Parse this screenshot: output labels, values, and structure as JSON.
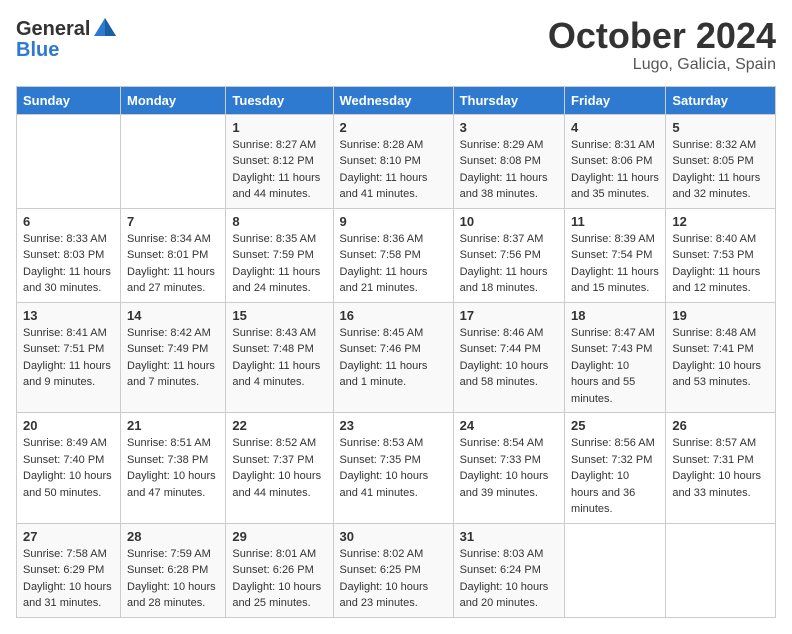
{
  "header": {
    "logo_line1": "General",
    "logo_line2": "Blue",
    "month": "October 2024",
    "location": "Lugo, Galicia, Spain"
  },
  "weekdays": [
    "Sunday",
    "Monday",
    "Tuesday",
    "Wednesday",
    "Thursday",
    "Friday",
    "Saturday"
  ],
  "weeks": [
    [
      {
        "day": "",
        "sunrise": "",
        "sunset": "",
        "daylight": ""
      },
      {
        "day": "",
        "sunrise": "",
        "sunset": "",
        "daylight": ""
      },
      {
        "day": "1",
        "sunrise": "Sunrise: 8:27 AM",
        "sunset": "Sunset: 8:12 PM",
        "daylight": "Daylight: 11 hours and 44 minutes."
      },
      {
        "day": "2",
        "sunrise": "Sunrise: 8:28 AM",
        "sunset": "Sunset: 8:10 PM",
        "daylight": "Daylight: 11 hours and 41 minutes."
      },
      {
        "day": "3",
        "sunrise": "Sunrise: 8:29 AM",
        "sunset": "Sunset: 8:08 PM",
        "daylight": "Daylight: 11 hours and 38 minutes."
      },
      {
        "day": "4",
        "sunrise": "Sunrise: 8:31 AM",
        "sunset": "Sunset: 8:06 PM",
        "daylight": "Daylight: 11 hours and 35 minutes."
      },
      {
        "day": "5",
        "sunrise": "Sunrise: 8:32 AM",
        "sunset": "Sunset: 8:05 PM",
        "daylight": "Daylight: 11 hours and 32 minutes."
      }
    ],
    [
      {
        "day": "6",
        "sunrise": "Sunrise: 8:33 AM",
        "sunset": "Sunset: 8:03 PM",
        "daylight": "Daylight: 11 hours and 30 minutes."
      },
      {
        "day": "7",
        "sunrise": "Sunrise: 8:34 AM",
        "sunset": "Sunset: 8:01 PM",
        "daylight": "Daylight: 11 hours and 27 minutes."
      },
      {
        "day": "8",
        "sunrise": "Sunrise: 8:35 AM",
        "sunset": "Sunset: 7:59 PM",
        "daylight": "Daylight: 11 hours and 24 minutes."
      },
      {
        "day": "9",
        "sunrise": "Sunrise: 8:36 AM",
        "sunset": "Sunset: 7:58 PM",
        "daylight": "Daylight: 11 hours and 21 minutes."
      },
      {
        "day": "10",
        "sunrise": "Sunrise: 8:37 AM",
        "sunset": "Sunset: 7:56 PM",
        "daylight": "Daylight: 11 hours and 18 minutes."
      },
      {
        "day": "11",
        "sunrise": "Sunrise: 8:39 AM",
        "sunset": "Sunset: 7:54 PM",
        "daylight": "Daylight: 11 hours and 15 minutes."
      },
      {
        "day": "12",
        "sunrise": "Sunrise: 8:40 AM",
        "sunset": "Sunset: 7:53 PM",
        "daylight": "Daylight: 11 hours and 12 minutes."
      }
    ],
    [
      {
        "day": "13",
        "sunrise": "Sunrise: 8:41 AM",
        "sunset": "Sunset: 7:51 PM",
        "daylight": "Daylight: 11 hours and 9 minutes."
      },
      {
        "day": "14",
        "sunrise": "Sunrise: 8:42 AM",
        "sunset": "Sunset: 7:49 PM",
        "daylight": "Daylight: 11 hours and 7 minutes."
      },
      {
        "day": "15",
        "sunrise": "Sunrise: 8:43 AM",
        "sunset": "Sunset: 7:48 PM",
        "daylight": "Daylight: 11 hours and 4 minutes."
      },
      {
        "day": "16",
        "sunrise": "Sunrise: 8:45 AM",
        "sunset": "Sunset: 7:46 PM",
        "daylight": "Daylight: 11 hours and 1 minute."
      },
      {
        "day": "17",
        "sunrise": "Sunrise: 8:46 AM",
        "sunset": "Sunset: 7:44 PM",
        "daylight": "Daylight: 10 hours and 58 minutes."
      },
      {
        "day": "18",
        "sunrise": "Sunrise: 8:47 AM",
        "sunset": "Sunset: 7:43 PM",
        "daylight": "Daylight: 10 hours and 55 minutes."
      },
      {
        "day": "19",
        "sunrise": "Sunrise: 8:48 AM",
        "sunset": "Sunset: 7:41 PM",
        "daylight": "Daylight: 10 hours and 53 minutes."
      }
    ],
    [
      {
        "day": "20",
        "sunrise": "Sunrise: 8:49 AM",
        "sunset": "Sunset: 7:40 PM",
        "daylight": "Daylight: 10 hours and 50 minutes."
      },
      {
        "day": "21",
        "sunrise": "Sunrise: 8:51 AM",
        "sunset": "Sunset: 7:38 PM",
        "daylight": "Daylight: 10 hours and 47 minutes."
      },
      {
        "day": "22",
        "sunrise": "Sunrise: 8:52 AM",
        "sunset": "Sunset: 7:37 PM",
        "daylight": "Daylight: 10 hours and 44 minutes."
      },
      {
        "day": "23",
        "sunrise": "Sunrise: 8:53 AM",
        "sunset": "Sunset: 7:35 PM",
        "daylight": "Daylight: 10 hours and 41 minutes."
      },
      {
        "day": "24",
        "sunrise": "Sunrise: 8:54 AM",
        "sunset": "Sunset: 7:33 PM",
        "daylight": "Daylight: 10 hours and 39 minutes."
      },
      {
        "day": "25",
        "sunrise": "Sunrise: 8:56 AM",
        "sunset": "Sunset: 7:32 PM",
        "daylight": "Daylight: 10 hours and 36 minutes."
      },
      {
        "day": "26",
        "sunrise": "Sunrise: 8:57 AM",
        "sunset": "Sunset: 7:31 PM",
        "daylight": "Daylight: 10 hours and 33 minutes."
      }
    ],
    [
      {
        "day": "27",
        "sunrise": "Sunrise: 7:58 AM",
        "sunset": "Sunset: 6:29 PM",
        "daylight": "Daylight: 10 hours and 31 minutes."
      },
      {
        "day": "28",
        "sunrise": "Sunrise: 7:59 AM",
        "sunset": "Sunset: 6:28 PM",
        "daylight": "Daylight: 10 hours and 28 minutes."
      },
      {
        "day": "29",
        "sunrise": "Sunrise: 8:01 AM",
        "sunset": "Sunset: 6:26 PM",
        "daylight": "Daylight: 10 hours and 25 minutes."
      },
      {
        "day": "30",
        "sunrise": "Sunrise: 8:02 AM",
        "sunset": "Sunset: 6:25 PM",
        "daylight": "Daylight: 10 hours and 23 minutes."
      },
      {
        "day": "31",
        "sunrise": "Sunrise: 8:03 AM",
        "sunset": "Sunset: 6:24 PM",
        "daylight": "Daylight: 10 hours and 20 minutes."
      },
      {
        "day": "",
        "sunrise": "",
        "sunset": "",
        "daylight": ""
      },
      {
        "day": "",
        "sunrise": "",
        "sunset": "",
        "daylight": ""
      }
    ]
  ]
}
